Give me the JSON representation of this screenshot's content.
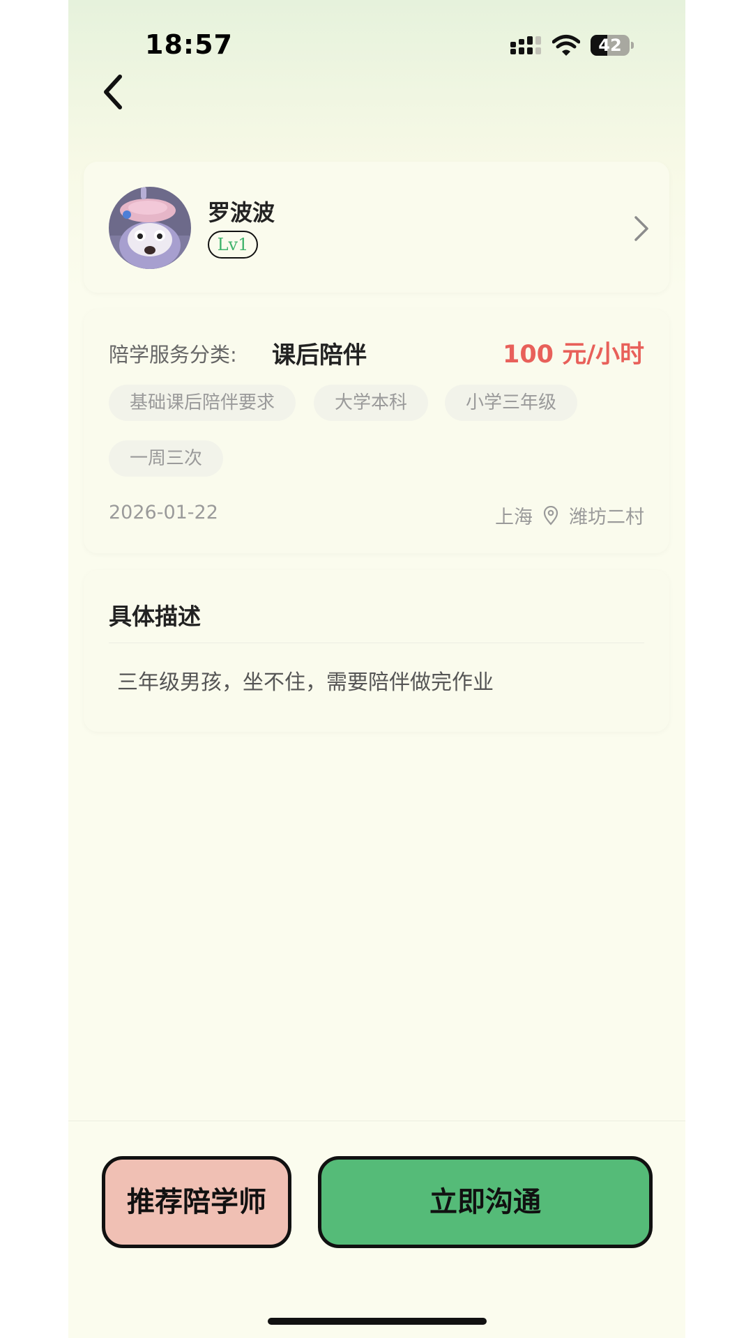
{
  "status_bar": {
    "time": "18:57",
    "battery": "42",
    "battery_level": 0.42
  },
  "profile": {
    "name": "罗波波",
    "level": "Lv1"
  },
  "service": {
    "category_label": "陪学服务分类:",
    "category_value": "课后陪伴",
    "price": "100 元/小时",
    "tags": [
      "基础课后陪伴要求",
      "大学本科",
      "小学三年级",
      "一周三次"
    ],
    "date": "2026-01-22",
    "city": "上海",
    "district": "潍坊二村"
  },
  "description": {
    "title": "具体描述",
    "text": "三年级男孩，坐不住，需要陪伴做完作业"
  },
  "actions": {
    "recommend_label": "推荐陪学师",
    "chat_label": "立即沟通"
  },
  "colors": {
    "price": "#e8605a",
    "level_text": "#3fb36b",
    "recommend_bg": "#f0c0b4",
    "chat_bg": "#55bb78",
    "background": "#fbfcee"
  },
  "icons": [
    "signal-icon",
    "wifi-icon",
    "battery-icon",
    "back-arrow-icon",
    "chevron-right-icon",
    "location-pin-icon"
  ]
}
